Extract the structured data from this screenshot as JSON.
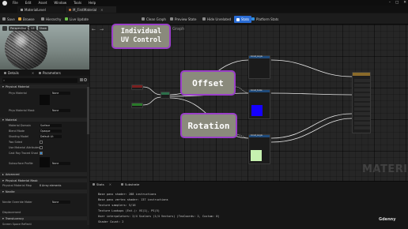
{
  "menu": [
    "File",
    "Edit",
    "Asset",
    "Window",
    "Tools",
    "Help"
  ],
  "window_controls": [
    "–",
    "□",
    "✕"
  ],
  "tabs": [
    {
      "label": "MaterialLevel",
      "icon": "level-icon"
    },
    {
      "label": "M_FirstMaterial",
      "icon": "material-icon"
    }
  ],
  "toolbar": {
    "save": "Save",
    "browse": "Browse",
    "hierarchy": "Hierarchy",
    "live_update": "Live Update",
    "clean_graph": "Clean Graph",
    "preview_state": "Preview State",
    "hide_unrelated": "Hide Unrelated",
    "stats": "Stats",
    "platform_stats": "Platform Stats"
  },
  "viewport": {
    "chips": [
      "Perspective",
      "Lit",
      "Show"
    ]
  },
  "details": {
    "tab_details": "Details",
    "tab_parameters": "Parameters",
    "sections": {
      "physical_material": "Physical Material",
      "material": "Material",
      "advanced": "Advanced",
      "physical_material_mask": "Physical Material Mask",
      "nanite": "Nanite",
      "translucency": "Translucency"
    },
    "props": [
      {
        "label": "Phys Material",
        "value": "None"
      },
      {
        "label": "Phys Material Mask",
        "value": "None"
      },
      {
        "label": "Material Domain",
        "value": "Surface"
      },
      {
        "label": "Blend Mode",
        "value": "Opaque"
      },
      {
        "label": "Shading Model",
        "value": "Default Lit"
      },
      {
        "label": "Two Sided",
        "value": ""
      },
      {
        "label": "Use Material Attributes",
        "value": ""
      },
      {
        "label": "Cast Ray Traced Shad",
        "value": ""
      },
      {
        "label": "Subsurface Profile",
        "value": "None"
      },
      {
        "label": "Physical Material Map",
        "value": "8 Array elements"
      },
      {
        "label": "Nanite Override Mater",
        "value": "None"
      },
      {
        "label": "Displacement",
        "value": ""
      },
      {
        "label": "Screen Space Reflecti",
        "value": ""
      }
    ]
  },
  "graph": {
    "breadcrumb": "Graph",
    "watermark": "MATERI",
    "node_titles": [
      "Const_Angle",
      "Const_Scale",
      "Const_Scale",
      "Const_Angle"
    ]
  },
  "annotations": {
    "uv_control": "Individual\nUV Control",
    "offset": "Offset",
    "rotation": "Rotation"
  },
  "stats": {
    "tab_stats": "Stats",
    "tab_substrate": "Substrate",
    "lines": [
      "Base pass shader: 288 instructions",
      "Base pass vertex shader: 137 instructions",
      "Texture samplers: 5/16",
      "Texture Lookups (Est.): VS(1), PS(5)",
      "User interpolators: 2/4 Scalars (1/4 Vectors) (TexCoords: 2, Custom: 0)",
      "Shader Count: 2"
    ]
  },
  "overlay_brand": "Gdenny",
  "colors": {
    "accent": "#2a6cd4",
    "card_fill": "#8a8a7c",
    "card_border": "#9a3ec8",
    "preview_blue": "#1500ff",
    "preview_green": "#c6f1b0"
  }
}
